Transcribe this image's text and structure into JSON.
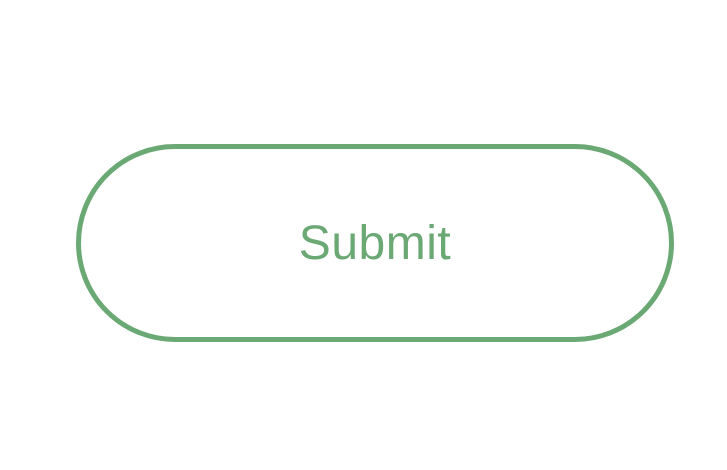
{
  "form": {
    "submit_label": "Submit"
  },
  "colors": {
    "accent": "#6aa874",
    "background": "#ffffff"
  }
}
